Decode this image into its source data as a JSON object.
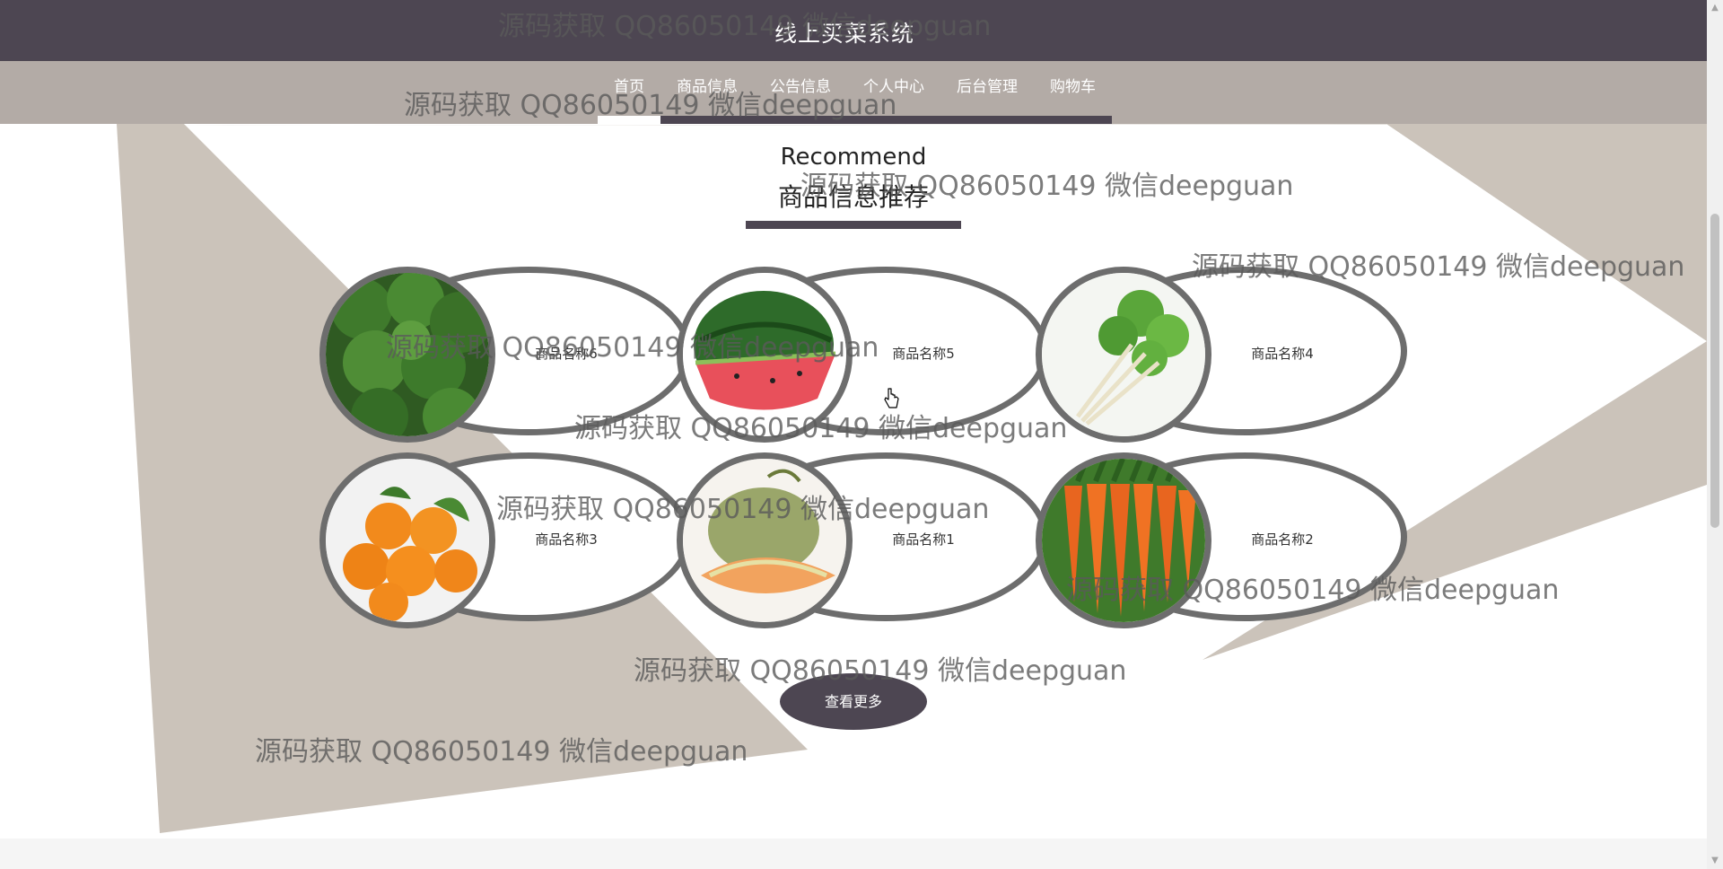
{
  "header": {
    "title": "线上买菜系统"
  },
  "nav": [
    {
      "label": "首页",
      "active": true
    },
    {
      "label": "商品信息"
    },
    {
      "label": "公告信息"
    },
    {
      "label": "个人中心"
    },
    {
      "label": "后台管理"
    },
    {
      "label": "购物车"
    }
  ],
  "section": {
    "title_en": "Recommend",
    "title_cn": "商品信息推荐"
  },
  "products": [
    {
      "name": "商品名称6",
      "image": "broccoli-image"
    },
    {
      "name": "商品名称5",
      "image": "watermelon-image"
    },
    {
      "name": "商品名称4",
      "image": "parsley-image"
    },
    {
      "name": "商品名称3",
      "image": "oranges-image"
    },
    {
      "name": "商品名称1",
      "image": "melon-image"
    },
    {
      "name": "商品名称2",
      "image": "carrots-image"
    }
  ],
  "more_button": "查看更多",
  "watermark": "源码获取 QQ86050149 微信deepguan",
  "colors": {
    "header": "#4d4652",
    "navbar": "#b3aba6",
    "decor": "#cbc3ba",
    "ring": "#6d6d6d"
  }
}
